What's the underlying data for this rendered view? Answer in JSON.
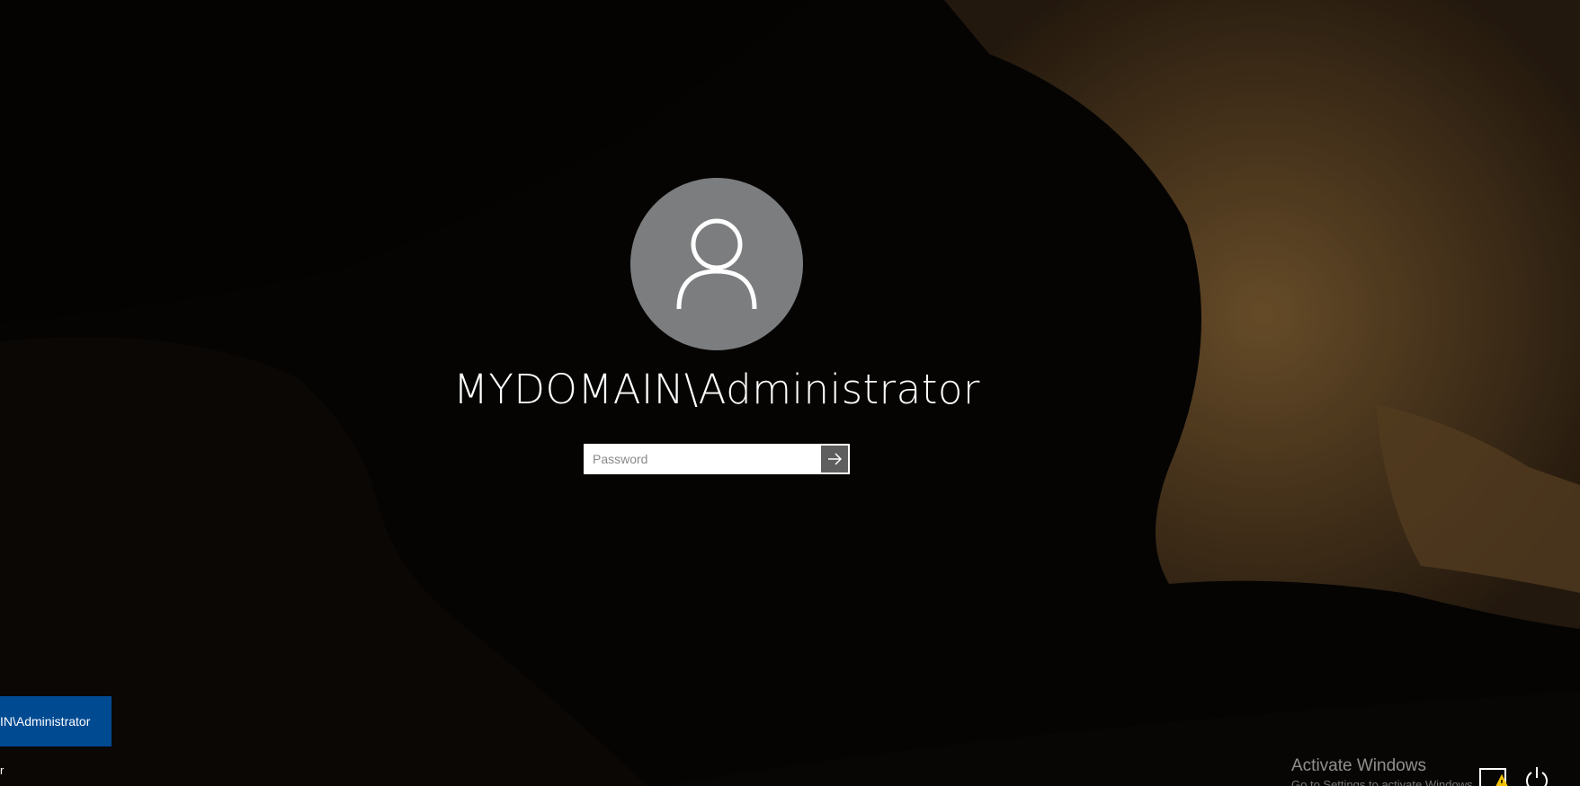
{
  "login": {
    "username": "MYDOMAIN\\Administrator",
    "password_placeholder": "Password"
  },
  "user_tile": {
    "label": "IN\\Administrator"
  },
  "other_user": {
    "label": "r"
  },
  "watermark": {
    "title": "Activate Windows",
    "subtitle": "Go to Settings to activate Windows."
  },
  "icons": {
    "avatar": "user-avatar-icon",
    "submit": "arrow-right-icon",
    "network": "network-icon",
    "power": "power-icon"
  },
  "colors": {
    "user_tile": "#004a92",
    "accent": "#004a92"
  }
}
